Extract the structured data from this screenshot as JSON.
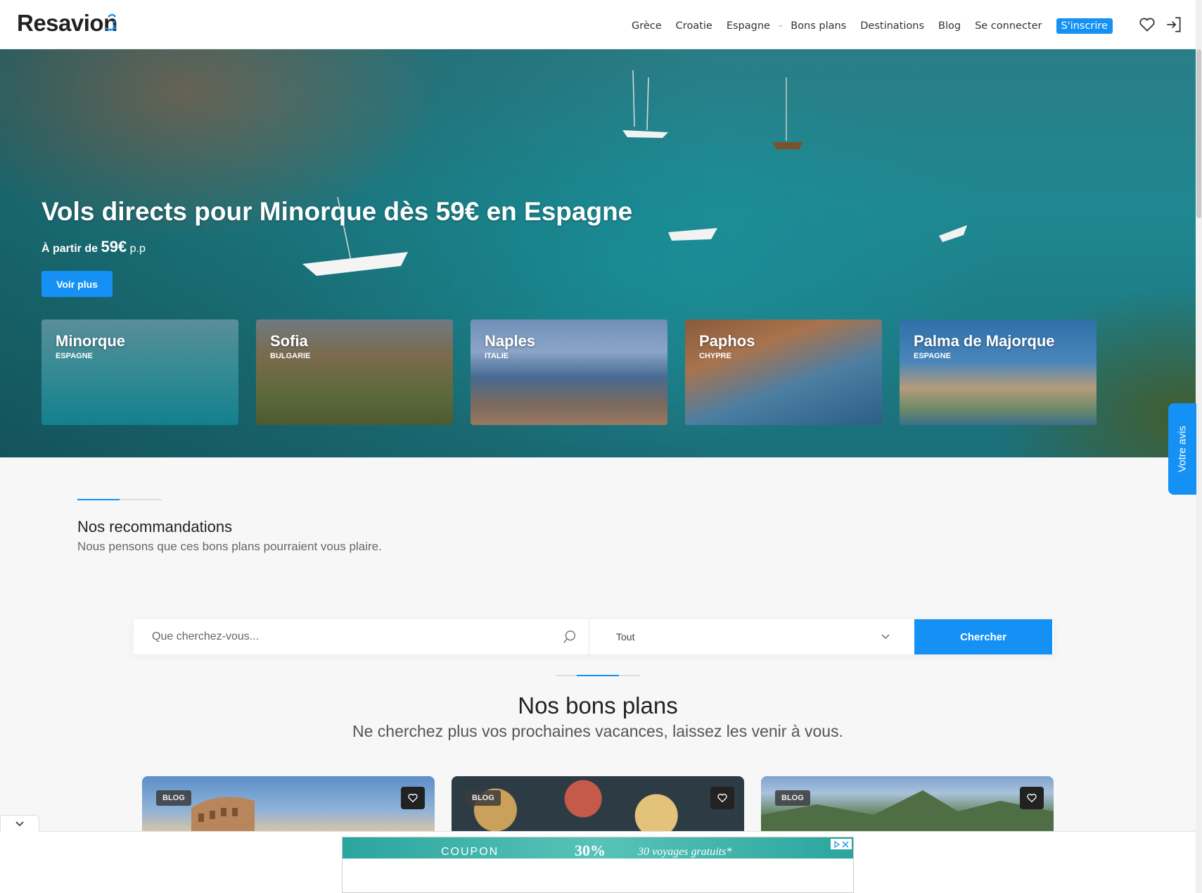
{
  "header": {
    "logo": "Resavion",
    "nav": [
      "Grèce",
      "Croatie",
      "Espagne",
      "Bons plans",
      "Destinations",
      "Blog",
      "Se connecter"
    ],
    "nav_sep": "-",
    "signup": "S'inscrire",
    "icons": [
      "heart-icon",
      "login-icon"
    ]
  },
  "hero": {
    "title": "Vols directs pour Minorque dès 59€ en Espagne",
    "from_label": "À partir de",
    "price": "59€",
    "per_person": "p.p",
    "cta": "Voir plus"
  },
  "destinations": [
    {
      "name": "Minorque",
      "country": "ESPAGNE"
    },
    {
      "name": "Sofia",
      "country": "BULGARIE"
    },
    {
      "name": "Naples",
      "country": "ITALIE"
    },
    {
      "name": "Paphos",
      "country": "CHYPRE"
    },
    {
      "name": "Palma de Majorque",
      "country": "ESPAGNE"
    }
  ],
  "feedback": "Votre avis",
  "recommendations": {
    "title": "Nos recommandations",
    "subtitle": "Nous pensons que ces bons plans pourraient vous plaire."
  },
  "search": {
    "placeholder": "Que cherchez-vous...",
    "select_value": "Tout",
    "button": "Chercher"
  },
  "bons_plans": {
    "title": "Nos bons plans",
    "subtitle": "Ne cherchez plus vos prochaines vacances, laissez les venir à vous.",
    "cards": [
      {
        "badge": "BLOG"
      },
      {
        "badge": "BLOG"
      },
      {
        "badge": "BLOG"
      }
    ]
  },
  "ad": {
    "text1": "COUPON",
    "text2": "30%",
    "text3": "30 voyages gratuits*"
  },
  "colors": {
    "accent": "#1591f5",
    "text": "#222222",
    "background": "#f7f7f7"
  }
}
